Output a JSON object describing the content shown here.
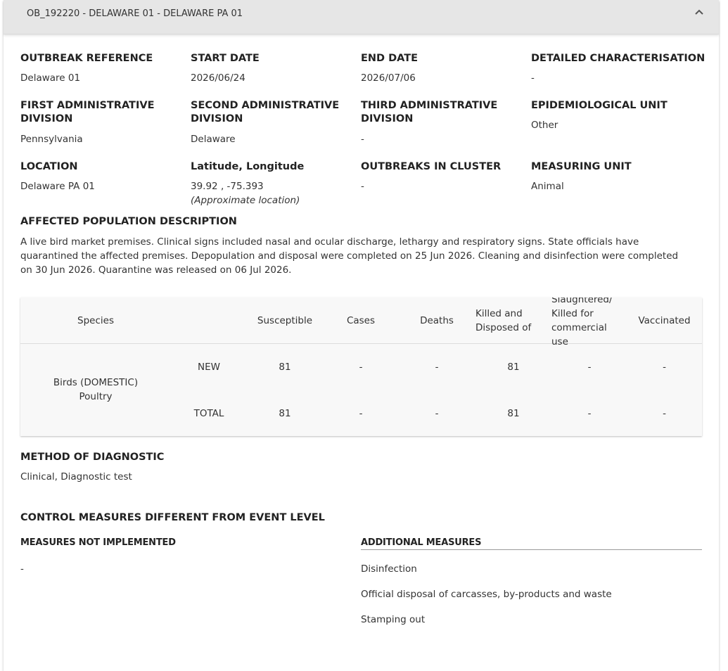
{
  "header": {
    "title": "OB_192220 - DELAWARE 01 - DELAWARE PA 01"
  },
  "fields": {
    "outbreak_reference": {
      "label": "OUTBREAK REFERENCE",
      "value": "Delaware 01"
    },
    "start_date": {
      "label": "START DATE",
      "value": "2026/06/24"
    },
    "end_date": {
      "label": "END DATE",
      "value": "2026/07/06"
    },
    "detailed_characterisation": {
      "label": "DETAILED CHARACTERISATION",
      "value": "-"
    },
    "first_admin": {
      "label_line1": "FIRST ADMINISTRATIVE",
      "label_line2": "DIVISION",
      "value": "Pennsylvania"
    },
    "second_admin": {
      "label_line1": "SECOND ADMINISTRATIVE",
      "label_line2": "DIVISION",
      "value": "Delaware"
    },
    "third_admin": {
      "label_line1": "THIRD ADMINISTRATIVE",
      "label_line2": "DIVISION",
      "value": "-"
    },
    "epidemiological_unit": {
      "label": "EPIDEMIOLOGICAL UNIT",
      "value": "Other"
    },
    "location": {
      "label": "LOCATION",
      "value": "Delaware PA 01"
    },
    "lat_long": {
      "label": "Latitude, Longitude",
      "value": "39.92 , -75.393",
      "note": "(Approximate location)"
    },
    "outbreaks_in_cluster": {
      "label": "OUTBREAKS IN CLUSTER",
      "value": "-"
    },
    "measuring_unit": {
      "label": "MEASURING UNIT",
      "value": "Animal"
    }
  },
  "affected_population": {
    "label": "AFFECTED POPULATION DESCRIPTION",
    "text": "A live bird market premises. Clinical signs included nasal and ocular discharge, lethargy and respiratory signs. State officials have quarantined the affected premises. Depopulation and disposal were completed on 25 Jun 2026. Cleaning and disinfection were completed on 30 Jun 2026. Quarantine was released on 06 Jul 2026."
  },
  "species_table": {
    "headers": {
      "species": "Species",
      "susceptible": "Susceptible",
      "cases": "Cases",
      "deaths": "Deaths",
      "killed_line1": "Killed and",
      "killed_line2": "Disposed of",
      "slaughtered_line1": "Slaughtered/",
      "slaughtered_line2": "Killed for",
      "slaughtered_line3": "commercial",
      "slaughtered_line4": "use",
      "vaccinated": "Vaccinated"
    },
    "species_line1": "Birds (DOMESTIC)",
    "species_line2": "Poultry",
    "rows": [
      {
        "type": "NEW",
        "susceptible": "81",
        "cases": "-",
        "deaths": "-",
        "killed": "81",
        "slaughtered": "-",
        "vaccinated": "-"
      },
      {
        "type": "TOTAL",
        "susceptible": "81",
        "cases": "-",
        "deaths": "-",
        "killed": "81",
        "slaughtered": "-",
        "vaccinated": "-"
      }
    ]
  },
  "diagnostic": {
    "label": "METHOD OF DIAGNOSTIC",
    "value": "Clinical, Diagnostic test"
  },
  "control_measures": {
    "label": "CONTROL MEASURES DIFFERENT FROM EVENT LEVEL",
    "not_implemented_label": "MEASURES NOT IMPLEMENTED",
    "not_implemented_value": "-",
    "additional_label": "ADDITIONAL MEASURES",
    "additional": [
      "Disinfection",
      "Official disposal of carcasses, by-products and waste",
      "Stamping out"
    ]
  }
}
